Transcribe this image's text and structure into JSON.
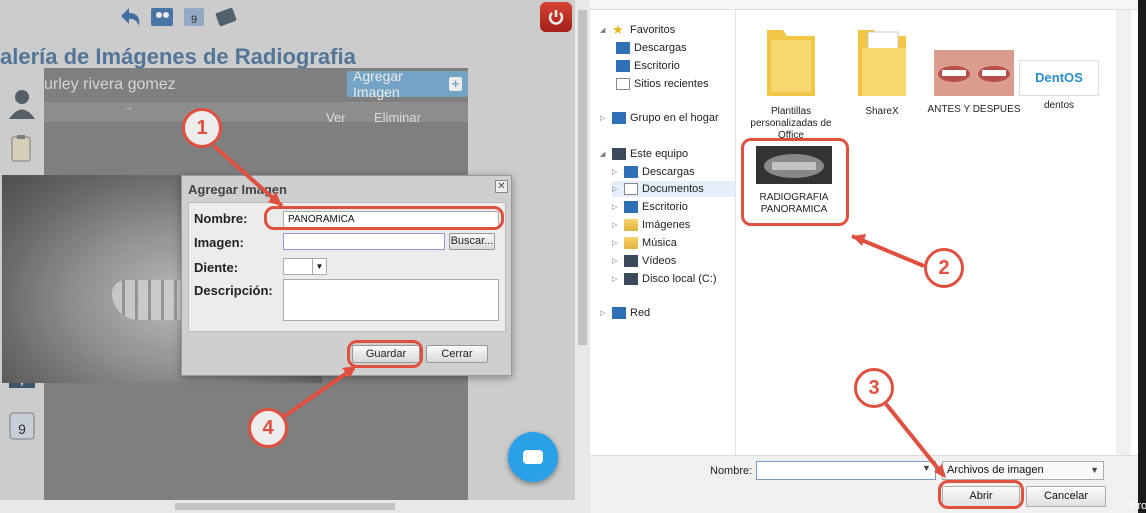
{
  "web": {
    "gallery_title": "alería de Imágenes de Radiografia",
    "patient_name": "urley rivera gomez",
    "add_image_label": "Agregar Imagen",
    "col_ver": "Ver",
    "col_eliminar": "Eliminar",
    "arrow_glyph": "→"
  },
  "modal": {
    "title": "Agregar Imagen",
    "close": "✕",
    "nombre_label": "Nombre:",
    "nombre_value": "PANORAMICA",
    "imagen_label": "Imagen:",
    "buscar_label": "Buscar...",
    "diente_label": "Diente:",
    "descripcion_label": "Descripción:",
    "guardar_label": "Guardar",
    "cerrar_label": "Cerrar"
  },
  "file_dialog": {
    "tree": {
      "favoritos": "Favoritos",
      "descargas": "Descargas",
      "escritorio": "Escritorio",
      "sitios_recientes": "Sitios recientes",
      "grupo_hogar": "Grupo en el hogar",
      "este_equipo": "Este equipo",
      "descargas2": "Descargas",
      "documentos": "Documentos",
      "escritorio2": "Escritorio",
      "imagenes": "Imágenes",
      "musica": "Música",
      "videos": "Vídeos",
      "disco_local": "Disco local (C:)",
      "red": "Red"
    },
    "files": {
      "plantillas": "Plantillas personalizadas de Office",
      "sharex": "ShareX",
      "antes_despues": "ANTES Y DESPUES",
      "dentos": "dentos",
      "dentos_logo": "DentOS",
      "radiografia": "RADIOGRAFIA PANORAMICA"
    },
    "nombre_label": "Nombre:",
    "filter_value": "Archivos de imagen",
    "abrir_label": "Abrir",
    "cancelar_label": "Cancelar"
  },
  "taskbar": {
    "pro_text": "Pro"
  },
  "annotations": {
    "n1": "1",
    "n2": "2",
    "n3": "3",
    "n4": "4"
  },
  "colors": {
    "annotation": "#e05040",
    "accent_blue": "#7eb2d6",
    "title_blue": "#5b7fa5"
  },
  "icons": [
    "back-arrow-icon",
    "patients-icon",
    "calendar-icon",
    "tools-icon",
    "power-icon",
    "doctor-icon",
    "clipboard-icon",
    "tooth-icon",
    "dental-chart-icon",
    "camera-icon",
    "dental-chair-icon",
    "xray-monitor-icon",
    "calendar-9-icon",
    "chat-icon",
    "star-icon",
    "folder-icon"
  ]
}
